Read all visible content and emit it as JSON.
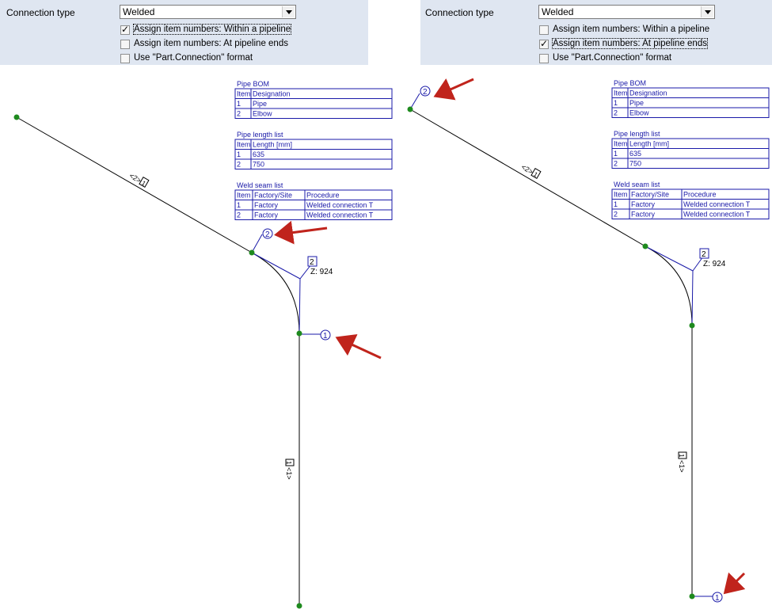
{
  "left": {
    "connection_type_label": "Connection type",
    "connection_type_value": "Welded",
    "options": [
      {
        "label": "Assign item numbers: Within a pipeline",
        "checked": true
      },
      {
        "label": "Assign item numbers: At pipeline ends",
        "checked": false
      },
      {
        "label": "Use \"Part.Connection\" format",
        "checked": false
      }
    ]
  },
  "right": {
    "connection_type_label": "Connection type",
    "connection_type_value": "Welded",
    "options": [
      {
        "label": "Assign item numbers: Within a pipeline",
        "checked": false
      },
      {
        "label": "Assign item numbers: At pipeline ends",
        "checked": true
      },
      {
        "label": "Use \"Part.Connection\" format",
        "checked": false
      }
    ]
  },
  "tables": {
    "pipe_bom": {
      "title": "Pipe BOM",
      "headers": [
        "Item",
        "Designation"
      ],
      "rows": [
        [
          "1",
          "Pipe"
        ],
        [
          "2",
          "Elbow"
        ]
      ]
    },
    "pipe_length": {
      "title": "Pipe length list",
      "headers": [
        "Item",
        "Length [mm]"
      ],
      "rows": [
        [
          "1",
          "635"
        ],
        [
          "2",
          "750"
        ]
      ]
    },
    "weld_seam": {
      "title": "Weld seam list",
      "headers": [
        "Item",
        "Factory/Site",
        "Procedure"
      ],
      "rows": [
        [
          "1",
          "Factory",
          "Welded connection T"
        ],
        [
          "2",
          "Factory",
          "Welded connection T"
        ]
      ]
    }
  },
  "drawing": {
    "left_labels": {
      "weld_a": "2",
      "weld_b": "1",
      "elbow_tag": "2",
      "z_text": "Z: 924",
      "pipe_tag_upper": "<2>",
      "pipe_tag_upper_box": "1",
      "pipe_tag_lower": "<1>",
      "pipe_tag_lower_box": "1"
    },
    "right_labels": {
      "weld_a": "2",
      "weld_b": "1",
      "elbow_tag": "2",
      "z_text": "Z: 924",
      "pipe_tag_upper": "<2>",
      "pipe_tag_upper_box": "1",
      "pipe_tag_lower": "<1>",
      "pipe_tag_lower_box": "1"
    },
    "colors": {
      "line": "#000000",
      "annotation": "#1a1aa8",
      "node": "#1e8a1e",
      "arrow": "#c0241c",
      "panel": "#dfe6f1"
    }
  }
}
